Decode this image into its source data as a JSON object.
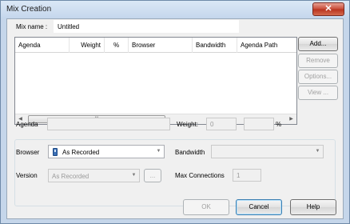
{
  "window": {
    "title": "Mix Creation",
    "close_glyph": "✕"
  },
  "mix_name": {
    "label": "Mix name :",
    "value": "Untitled"
  },
  "list": {
    "columns": [
      "Agenda",
      "Weight",
      "%",
      "Browser",
      "Bandwidth",
      "Agenda Path"
    ],
    "rows": [],
    "scroll_left": "◀",
    "scroll_right": "▶",
    "thumb_grip": "III"
  },
  "side_buttons": {
    "add": "Add...",
    "remove": "Remove",
    "options": "Options...",
    "view": "View ..."
  },
  "agenda": {
    "label": "Agenda",
    "value": ""
  },
  "weight": {
    "label": "Weight:",
    "value": "0",
    "percent_value": "",
    "percent_sign": "%"
  },
  "browser": {
    "label": "Browser",
    "value": "As Recorded",
    "icon": "phone-icon"
  },
  "bandwidth": {
    "label": "Bandwidth",
    "value": ""
  },
  "version": {
    "label": "Version",
    "value": "As Recorded",
    "browse_label": "..."
  },
  "max_connections": {
    "label": "Max Connections",
    "value": "1"
  },
  "footer": {
    "ok": "OK",
    "cancel": "Cancel",
    "help": "Help"
  }
}
